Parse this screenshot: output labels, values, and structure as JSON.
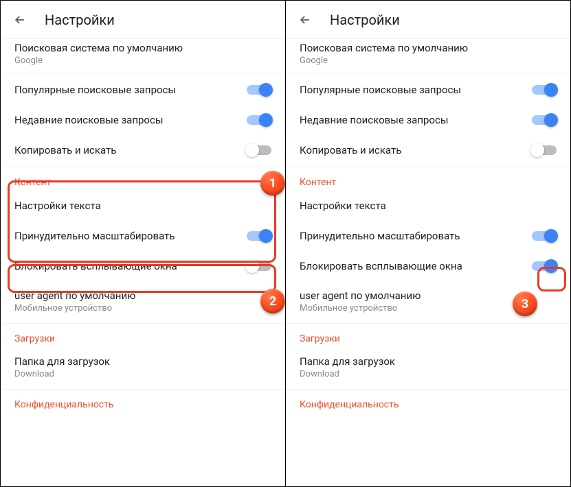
{
  "header": {
    "title": "Настройки"
  },
  "search_engine": {
    "title": "Поисковая система по умолчанию",
    "value": "Google"
  },
  "popular_queries": {
    "label": "Популярные поисковые запросы"
  },
  "recent_queries": {
    "label": "Недавние поисковые запросы"
  },
  "copy_search": {
    "label": "Копировать и искать"
  },
  "content_section": "Контент",
  "text_settings": {
    "label": "Настройки текста"
  },
  "force_zoom": {
    "label": "Принудительно масштабировать"
  },
  "block_popups": {
    "label": "Блокировать всплывающие окна"
  },
  "user_agent": {
    "label": "user agent по умолчанию",
    "value": "Мобильное устройство"
  },
  "downloads_section": "Загрузки",
  "download_folder": {
    "label": "Папка для загрузок",
    "value": "Download"
  },
  "privacy_section": "Конфиденциальность",
  "markers": {
    "one": "1",
    "two": "2",
    "three": "3"
  }
}
